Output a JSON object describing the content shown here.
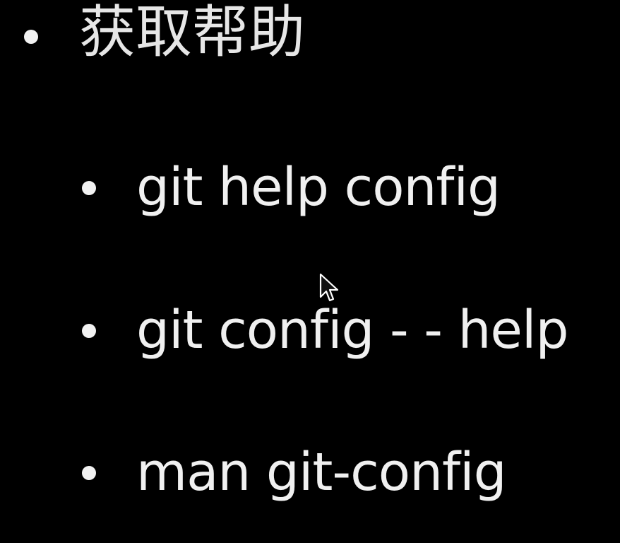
{
  "slide": {
    "heading": "获取帮助",
    "items": [
      {
        "text": "git help config"
      },
      {
        "text": "git config - - help"
      },
      {
        "text": "man git-config"
      }
    ]
  },
  "colors": {
    "background": "#000000",
    "text": "#f0f0f0",
    "bullet": "#f2f2f2"
  },
  "icons": {
    "cursor": "mouse-pointer-icon",
    "bullet": "bullet-dot-icon"
  }
}
